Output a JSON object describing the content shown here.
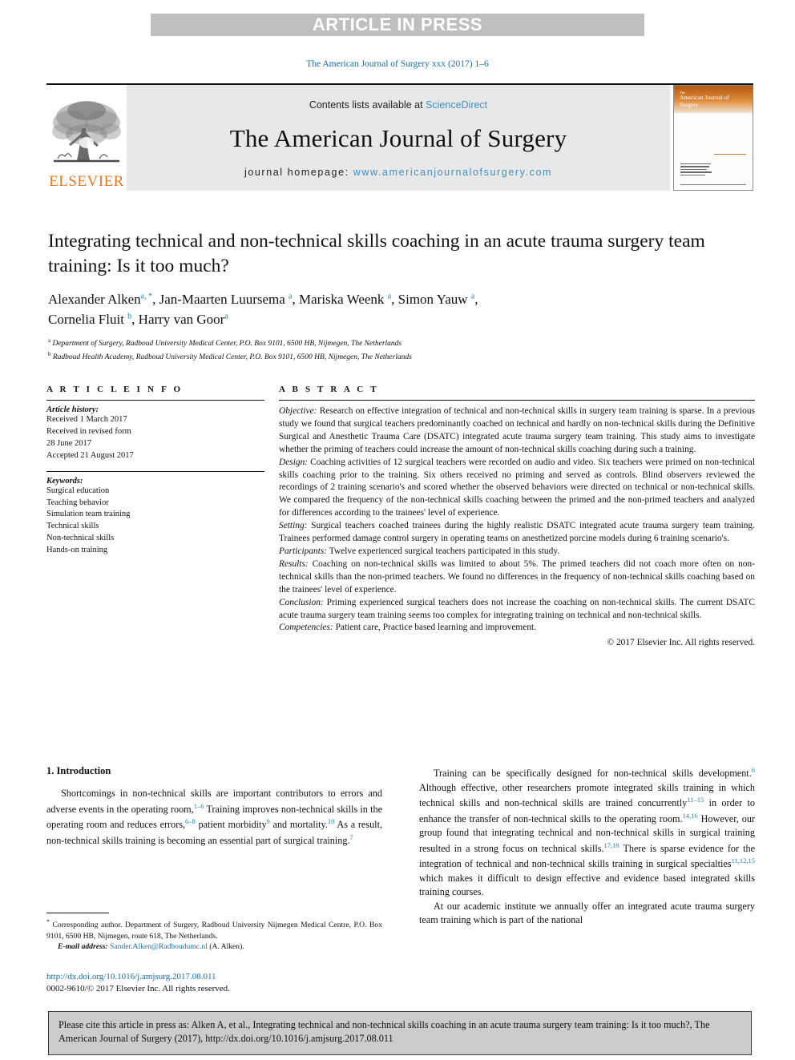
{
  "banner": {
    "text": "ARTICLE IN PRESS"
  },
  "running_head": "The American Journal of Surgery xxx (2017) 1–6",
  "masthead": {
    "publisher": "ELSEVIER",
    "contents_prefix": "Contents lists available at ",
    "contents_link": "ScienceDirect",
    "journal_name": "The American Journal of Surgery",
    "homepage_prefix": "journal homepage: ",
    "homepage_link": "www.americanjournalofsurgery.com",
    "cover_title_small": "The",
    "cover_title": "American Journal of Surgery"
  },
  "article": {
    "title": "Integrating technical and non-technical skills coaching in an acute trauma surgery team training: Is it too much?",
    "authors_line1": "Alexander Alken",
    "authors": [
      {
        "name": "Alexander Alken",
        "sup": "a, *"
      },
      {
        "name": "Jan-Maarten Luursema",
        "sup": "a"
      },
      {
        "name": "Mariska Weenk",
        "sup": "a"
      },
      {
        "name": "Simon Yauw",
        "sup": "a"
      },
      {
        "name": "Cornelia Fluit",
        "sup": "b"
      },
      {
        "name": "Harry van Goor",
        "sup": "a"
      }
    ],
    "affiliations": [
      {
        "marker": "a",
        "text": "Department of Surgery, Radboud University Medical Center, P.O. Box 9101, 6500 HB, Nijmegen, The Netherlands"
      },
      {
        "marker": "b",
        "text": "Radboud Health Academy, Radboud University Medical Center, P.O. Box 9101, 6500 HB, Nijmegen, The Netherlands"
      }
    ]
  },
  "article_info": {
    "heading": "A R T I C L E   I N F O",
    "history_label": "Article history:",
    "history": [
      "Received 1 March 2017",
      "Received in revised form",
      "28 June 2017",
      "Accepted 21 August 2017"
    ],
    "keywords_label": "Keywords:",
    "keywords": [
      "Surgical education",
      "Teaching behavior",
      "Simulation team training",
      "Technical skills",
      "Non-technical skills",
      "Hands-on training"
    ]
  },
  "abstract": {
    "heading": "A B S T R A C T",
    "sections": [
      {
        "label": "Objective:",
        "text": "Research on effective integration of technical and non-technical skills in surgery team training is sparse. In a previous study we found that surgical teachers predominantly coached on technical and hardly on non-technical skills during the Definitive Surgical and Anesthetic Trauma Care (DSATC) integrated acute trauma surgery team training. This study aims to investigate whether the priming of teachers could increase the amount of non-technical skills coaching during such a training."
      },
      {
        "label": "Design:",
        "text": "Coaching activities of 12 surgical teachers were recorded on audio and video. Six teachers were primed on non-technical skills coaching prior to the training. Six others received no priming and served as controls. Blind observers reviewed the recordings of 2 training scenario's and scored whether the observed behaviors were directed on technical or non-technical skills. We compared the frequency of the non-technical skills coaching between the primed and the non-primed teachers and analyzed for differences according to the trainees' level of experience."
      },
      {
        "label": "Setting:",
        "text": "Surgical teachers coached trainees during the highly realistic DSATC integrated acute trauma surgery team training. Trainees performed damage control surgery in operating teams on anesthetized porcine models during 6 training scenario's."
      },
      {
        "label": "Participants:",
        "text": "Twelve experienced surgical teachers participated in this study."
      },
      {
        "label": "Results:",
        "text": "Coaching on non-technical skills was limited to about 5%. The primed teachers did not coach more often on non-technical skills than the non-primed teachers. We found no differences in the frequency of non-technical skills coaching based on the trainees' level of experience."
      },
      {
        "label": "Conclusion:",
        "text": "Priming experienced surgical teachers does not increase the coaching on non-technical skills. The current DSATC acute trauma surgery team training seems too complex for integrating training on technical and non-technical skills."
      },
      {
        "label": "Competencies:",
        "text": "Patient care, Practice based learning and improvement."
      }
    ],
    "copyright": "© 2017 Elsevier Inc. All rights reserved."
  },
  "introduction": {
    "heading": "1. Introduction",
    "left_paragraphs": [
      "Shortcomings in non-technical skills are important contributors to errors and adverse events in the operating room,<sup>1–6</sup> Training improves non-technical skills in the operating room and reduces errors,<sup>6–8</sup> patient morbidity<sup>9</sup> and mortality.<sup>10</sup> As a result, non-technical skills training is becoming an essential part of surgical training.<sup>7</sup>"
    ],
    "right_paragraphs": [
      "Training can be specifically designed for non-technical skills development.<sup>6</sup> Although effective, other researchers promote integrated skills training in which technical skills and non-technical skills are trained concurrently<sup>11–15</sup> in order to enhance the transfer of non-technical skills to the operating room.<sup>14,16</sup> However, our group found that integrating technical and non-technical skills in surgical training resulted in a strong focus on technical skills.<sup>17,18</sup> There is sparse evidence for the integration of technical and non-technical skills training in surgical specialties<sup>11,12,15</sup> which makes it difficult to design effective and evidence based integrated skills training courses.",
      "At our academic institute we annually offer an integrated acute trauma surgery team training which is part of the national"
    ]
  },
  "footnotes": {
    "corresponding": "Corresponding author. Department of Surgery, Radboud University Nijmegen Medical Centre, P.O. Box 9101, 6500 HB, Nijmegen, route 618, The Netherlands.",
    "email_label": "E-mail address:",
    "email": "Sander.Alken@Radboudumc.nl",
    "email_suffix": " (A. Alken).",
    "doi": "http://dx.doi.org/10.1016/j.amjsurg.2017.08.011",
    "issn": "0002-9610/© 2017 Elsevier Inc. All rights reserved."
  },
  "cite_box": {
    "text": "Please cite this article in press as: Alken A, et al., Integrating technical and non-technical skills coaching in an acute trauma surgery team training: Is it too much?, The American Journal of Surgery (2017), http://dx.doi.org/10.1016/j.amjsurg.2017.08.011"
  },
  "colors": {
    "link_blue": "#1a6ea8",
    "cite_blue": "#1a7fb5",
    "elsevier_orange": "#E87722",
    "banner_gray": "#bfbfbf",
    "masthead_gray": "#e8e8e8",
    "cite_box_gray": "#cccccc"
  }
}
